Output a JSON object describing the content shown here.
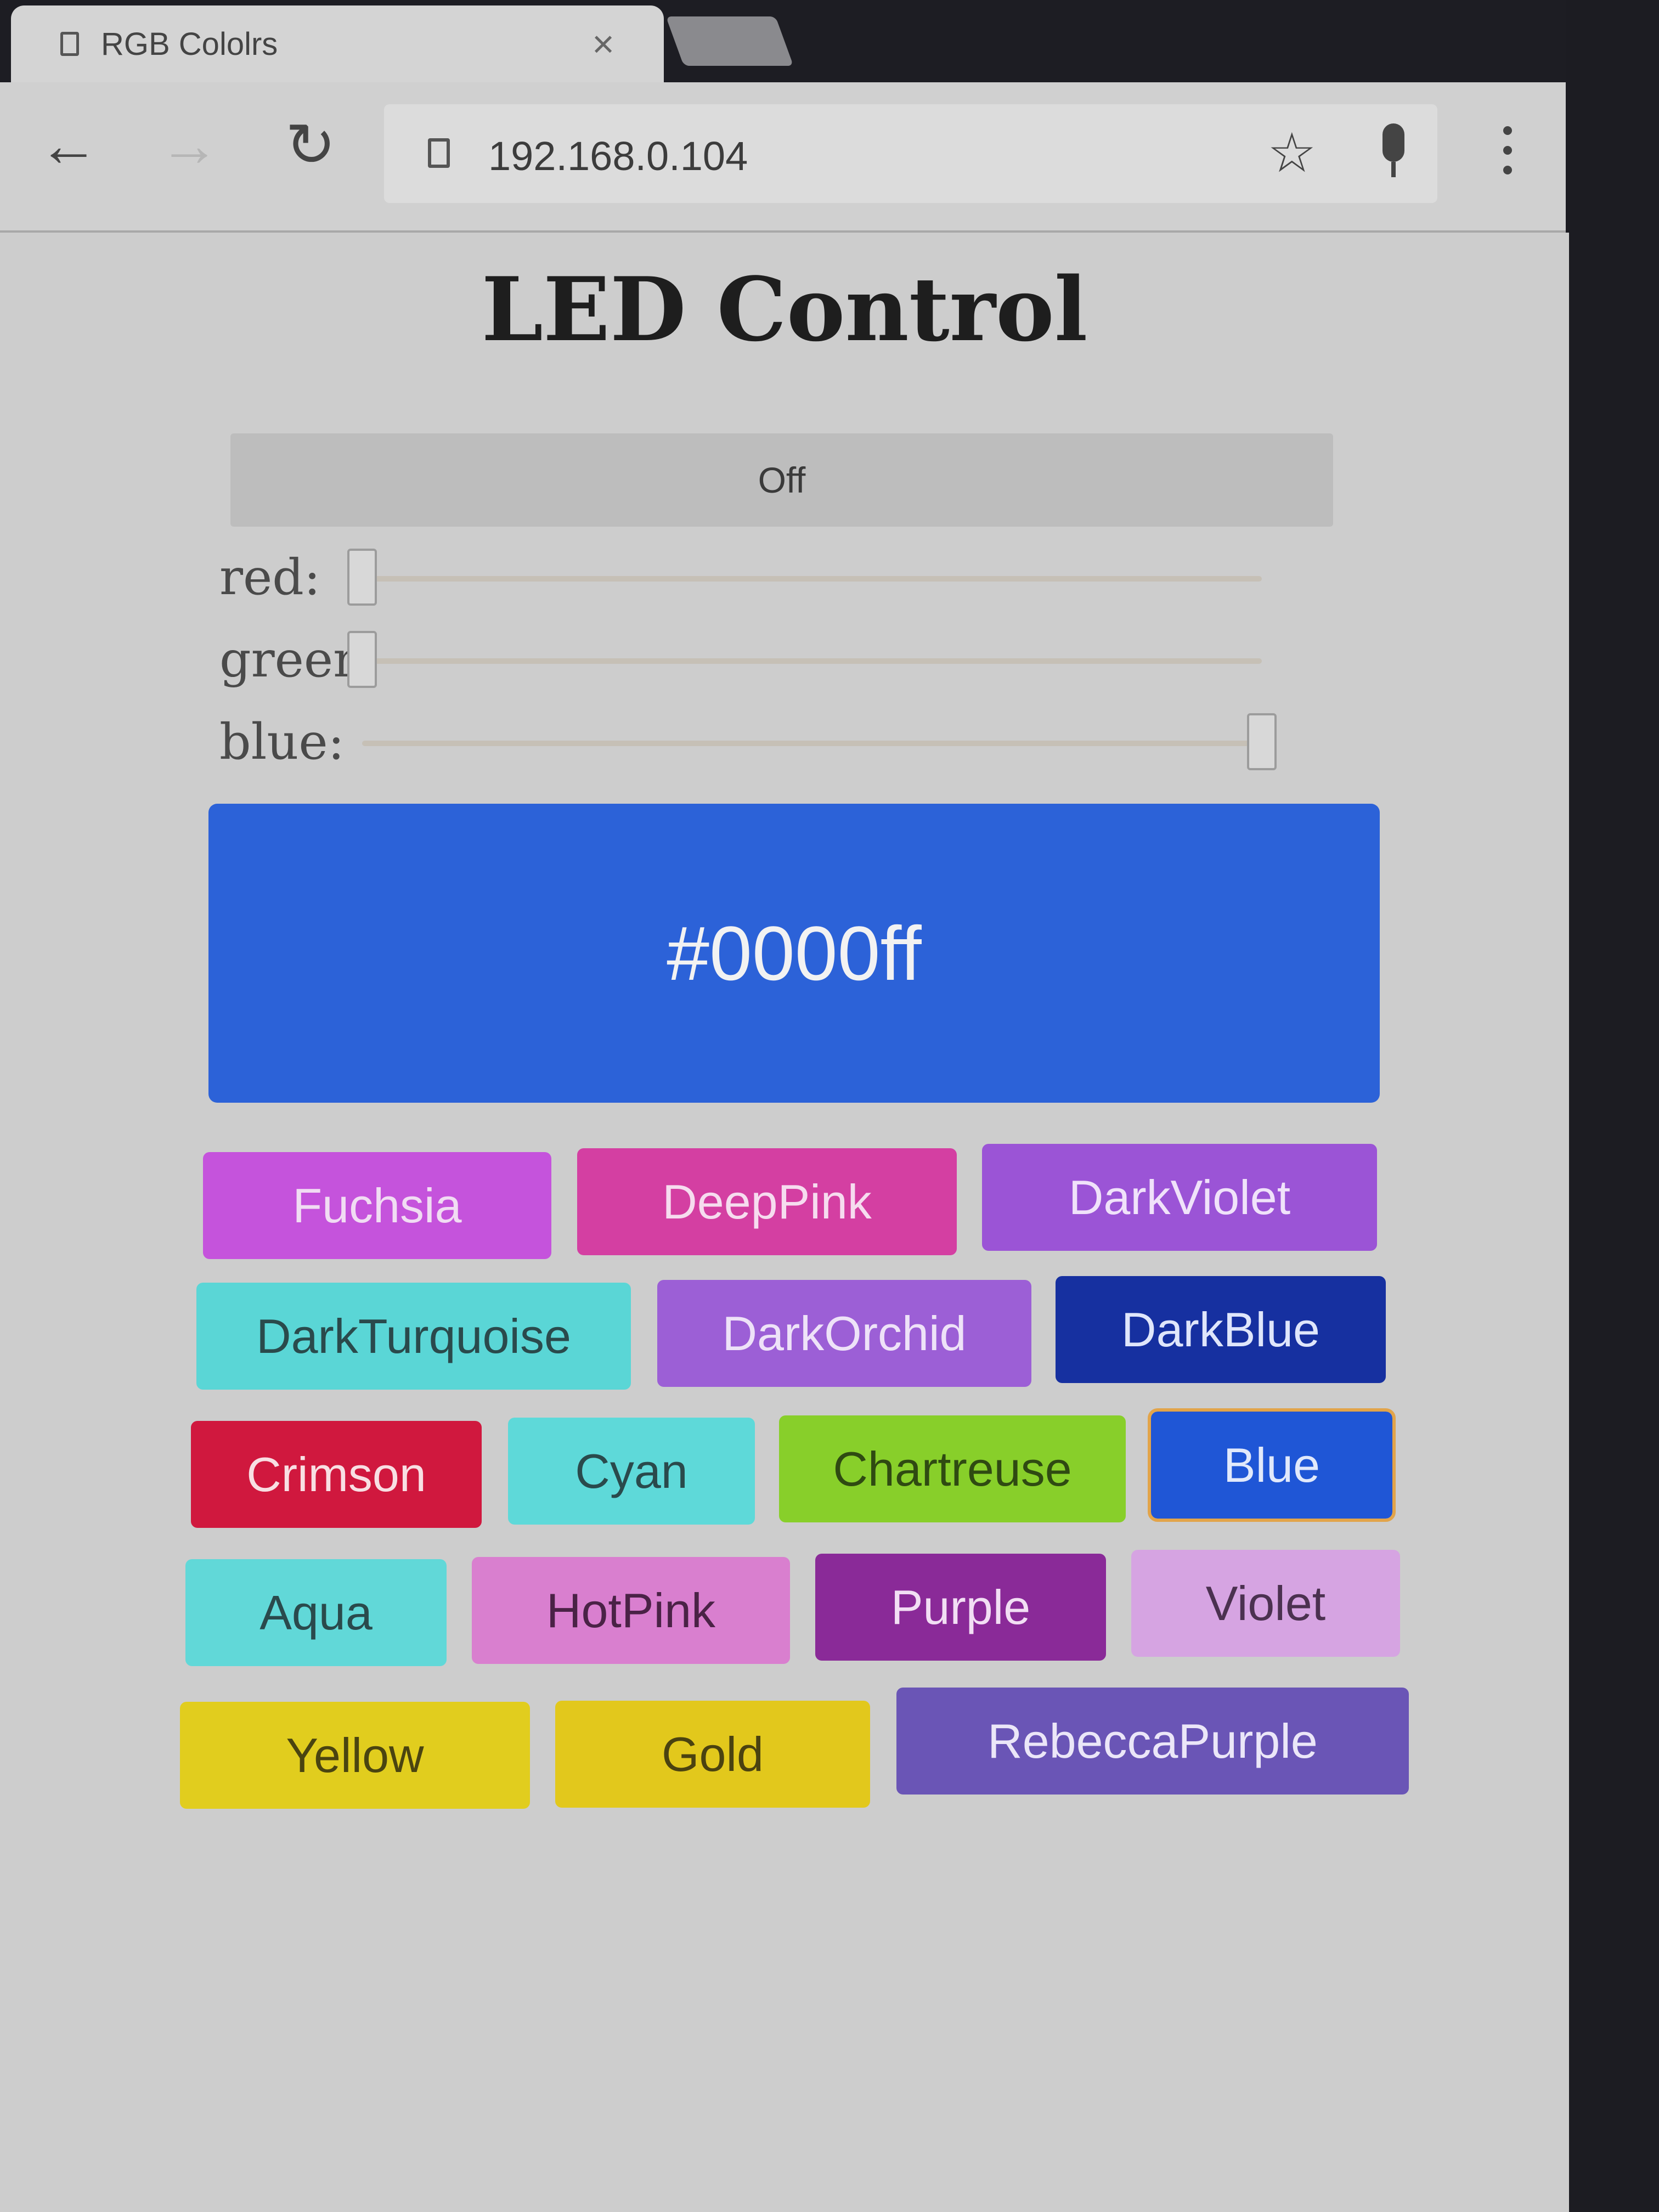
{
  "browser": {
    "tab_title": "RGB Cololrs",
    "tab_close": "×",
    "url": "192.168.0.104",
    "back": "←",
    "forward": "→",
    "reload": "↻",
    "star": "☆"
  },
  "page": {
    "title": "LED Control",
    "power_button": "Off",
    "sliders": {
      "red": {
        "label": "red:",
        "value": 0,
        "max": 255
      },
      "green": {
        "label": "green:",
        "value": 0,
        "max": 255
      },
      "blue": {
        "label": "blue:",
        "value": 255,
        "max": 255
      }
    },
    "current_color": {
      "hex": "#0000ff",
      "swatch": "#2c62d8"
    },
    "color_buttons": [
      {
        "label": "Fuchsia",
        "bg": "#c553dc",
        "fg": "#f1dcf3"
      },
      {
        "label": "DeepPink",
        "bg": "#d43fa2",
        "fg": "#f6dcef"
      },
      {
        "label": "DarkViolet",
        "bg": "#9b54d6",
        "fg": "#f0e2fa"
      },
      {
        "label": "DarkTurquoise",
        "bg": "#5ad6d6",
        "fg": "#2a4a4c"
      },
      {
        "label": "DarkOrchid",
        "bg": "#9c5fd6",
        "fg": "#eee2f8"
      },
      {
        "label": "DarkBlue",
        "bg": "#1630a0",
        "fg": "#dfe6fb"
      },
      {
        "label": "Crimson",
        "bg": "#d0183e",
        "fg": "#f8dfe3"
      },
      {
        "label": "Cyan",
        "bg": "#5ed9d9",
        "fg": "#2a4a4c"
      },
      {
        "label": "Chartreuse",
        "bg": "#88cf2a",
        "fg": "#2f4a12"
      },
      {
        "label": "Blue",
        "bg": "#1f56d6",
        "fg": "#e1e9fb"
      },
      {
        "label": "Aqua",
        "bg": "#61d8d8",
        "fg": "#2a4a4c"
      },
      {
        "label": "HotPink",
        "bg": "#d97fcf",
        "fg": "#4a2246"
      },
      {
        "label": "Purple",
        "bg": "#8a2a98",
        "fg": "#f2def4"
      },
      {
        "label": "Violet",
        "bg": "#d6a4e2",
        "fg": "#4b3150"
      },
      {
        "label": "Yellow",
        "bg": "#e1cd1e",
        "fg": "#4a4410"
      },
      {
        "label": "Gold",
        "bg": "#e2c81c",
        "fg": "#4a4210"
      },
      {
        "label": "RebeccaPurple",
        "bg": "#6a55b6",
        "fg": "#ebe6f8"
      }
    ]
  }
}
